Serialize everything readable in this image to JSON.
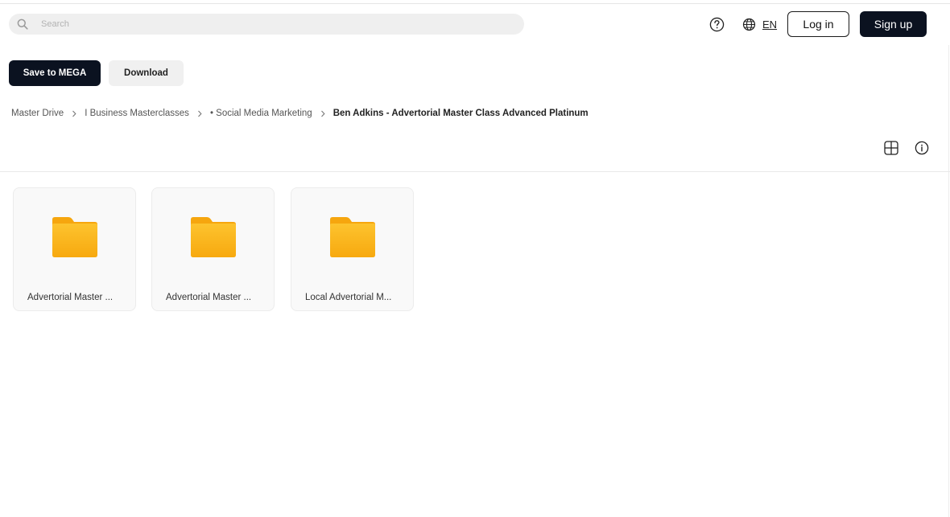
{
  "search": {
    "placeholder": "Search"
  },
  "header": {
    "language": "EN",
    "login_label": "Log in",
    "signup_label": "Sign up"
  },
  "actions": {
    "save_label": "Save to MEGA",
    "download_label": "Download"
  },
  "breadcrumb": [
    {
      "label": "Master Drive"
    },
    {
      "label": "I Business Masterclasses"
    },
    {
      "label": "• Social Media Marketing"
    },
    {
      "label": "Ben Adkins - Advertorial Master Class Advanced Platinum"
    }
  ],
  "folders": [
    {
      "name": "Advertorial Master ..."
    },
    {
      "name": "Advertorial Master ..."
    },
    {
      "name": "Local Advertorial M..."
    }
  ],
  "colors": {
    "primary_dark": "#0b1220",
    "folder_yellow": "#fbb316"
  },
  "icons": {
    "search": "search-icon",
    "help": "help-circle-icon",
    "language": "globe-icon",
    "breadcrumb_separator": "chevron-right-icon",
    "grid_view": "grid-view-icon",
    "info": "info-icon",
    "folder": "folder-icon"
  }
}
